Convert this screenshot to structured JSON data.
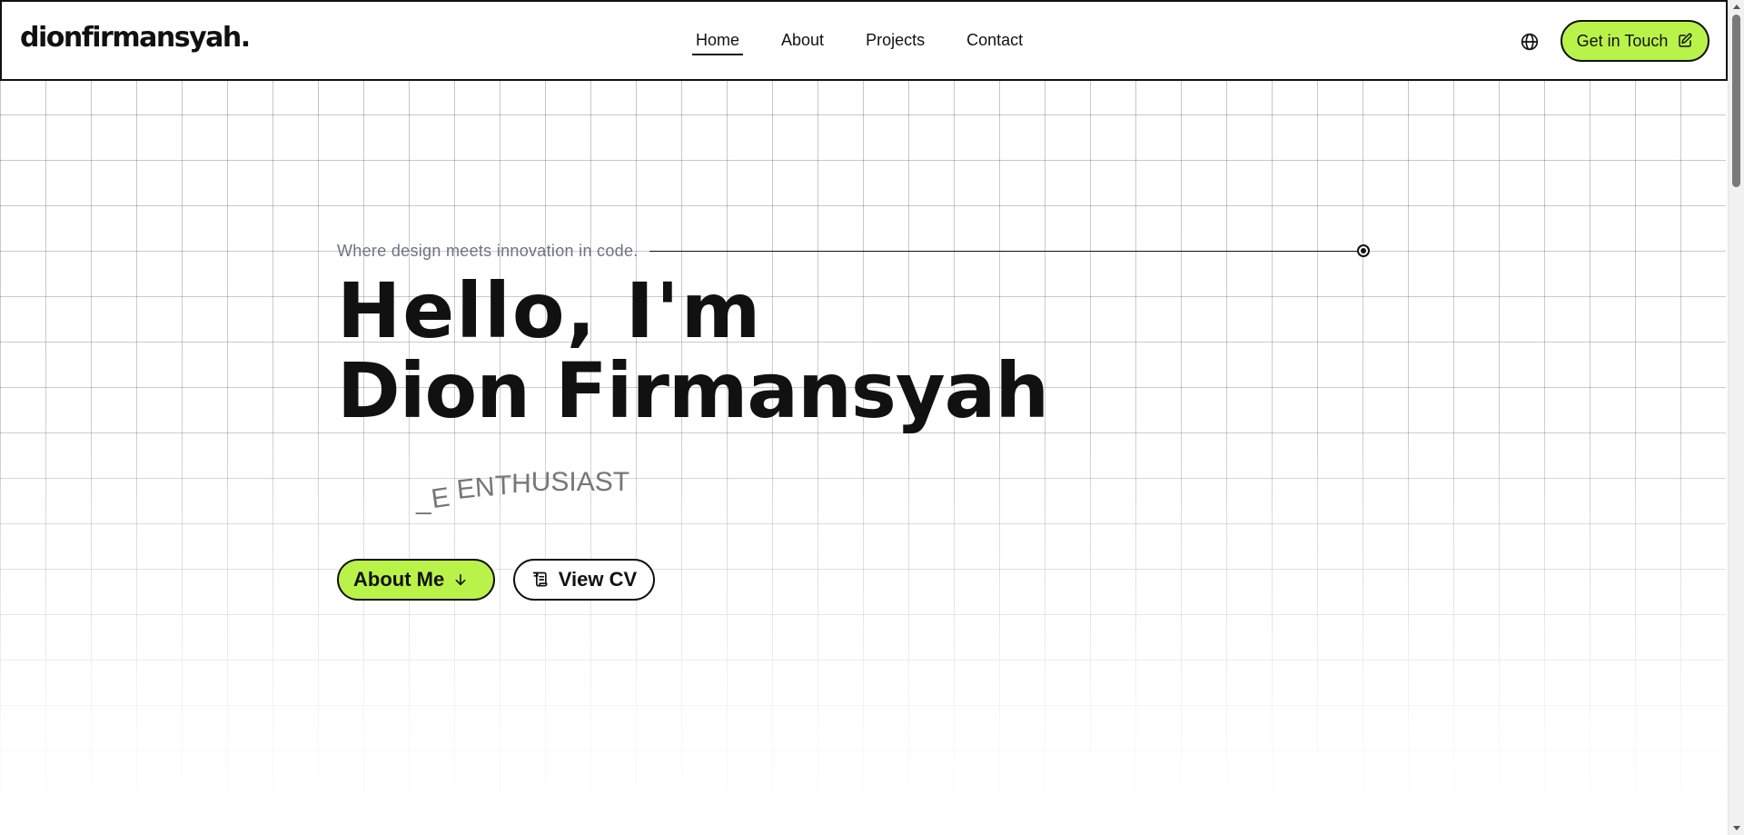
{
  "header": {
    "logo": "dionfirmansyah.",
    "nav": [
      {
        "label": "Home",
        "active": true
      },
      {
        "label": "About",
        "active": false
      },
      {
        "label": "Projects",
        "active": false
      },
      {
        "label": "Contact",
        "active": false
      }
    ],
    "language_icon": "globe-icon",
    "cta_label": "Get in Touch",
    "cta_icon": "edit-icon"
  },
  "hero": {
    "tagline": "Where design meets innovation in code.",
    "greeting": "Hello, I'm",
    "name": "Dion Firmansyah",
    "role_text": "_E ENTHUSIAST",
    "buttons": {
      "about": {
        "label": "About Me",
        "icon": "arrow-down-icon"
      },
      "cv": {
        "label": "View CV",
        "icon": "scroll-icon"
      }
    }
  },
  "colors": {
    "accent": "#b9f349",
    "text": "#111111",
    "muted": "#6b7280",
    "role": "#777777"
  }
}
